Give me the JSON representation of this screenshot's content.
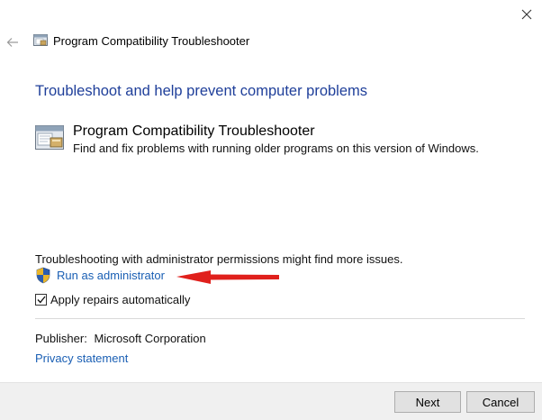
{
  "window": {
    "title": "Program Compatibility Troubleshooter"
  },
  "main": {
    "heading": "Troubleshoot and help prevent computer problems",
    "tool": {
      "name": "Program Compatibility Troubleshooter",
      "description": "Find and fix problems with running older programs on this version of Windows."
    },
    "admin_note": "Troubleshooting with administrator permissions might find more issues.",
    "run_as_admin_label": "Run as administrator",
    "apply_repairs": {
      "label": "Apply repairs automatically",
      "checked": true
    },
    "publisher_label": "Publisher:",
    "publisher_value": "Microsoft Corporation",
    "privacy_label": "Privacy statement"
  },
  "footer": {
    "next_label": "Next",
    "cancel_label": "Cancel"
  },
  "icons": [
    "close-icon",
    "back-arrow-icon",
    "troubleshooter-icon",
    "uac-shield-icon",
    "checkmark-icon"
  ],
  "colors": {
    "heading": "#1f3f9a",
    "link": "#1a5fb4",
    "annotation_arrow": "#e0201c",
    "footer_bg": "#f0f0f0"
  }
}
